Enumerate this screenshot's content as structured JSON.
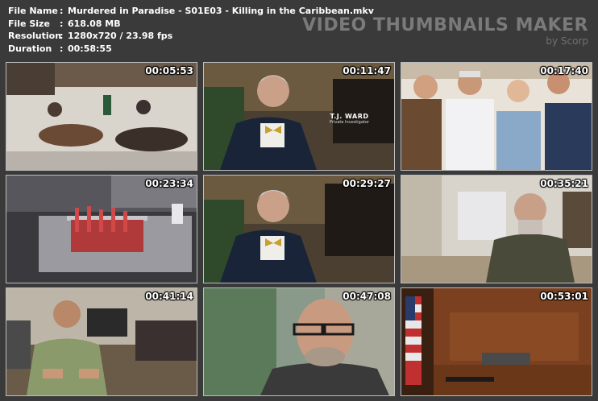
{
  "info": {
    "file_name_label": "File Name",
    "file_name": "Murdered in Paradise - S01E03 - Killing in the Caribbean.mkv",
    "file_size_label": "File Size",
    "file_size": "618.08 MB",
    "resolution_label": "Resolution",
    "resolution": "1280x720 / 23.98 fps",
    "duration_label": "Duration",
    "duration": "00:58:55",
    "separator": ":"
  },
  "brand": {
    "title": "VIDEO THUMBNAILS MAKER",
    "subtitle": "by Scorp"
  },
  "thumbnails": [
    {
      "timestamp": "00:05:53"
    },
    {
      "timestamp": "00:11:47",
      "caption_name": "T.J. WARD",
      "caption_role": "Private Investigator"
    },
    {
      "timestamp": "00:17:40"
    },
    {
      "timestamp": "00:23:34"
    },
    {
      "timestamp": "00:29:27"
    },
    {
      "timestamp": "00:35:21"
    },
    {
      "timestamp": "00:41:14"
    },
    {
      "timestamp": "00:47:08"
    },
    {
      "timestamp": "00:53:01"
    }
  ],
  "colors": {
    "background": "#3a3a3a",
    "frame_border": "#bdbdbd",
    "text": "#ffffff",
    "brand_text": "#7a7a7a"
  }
}
